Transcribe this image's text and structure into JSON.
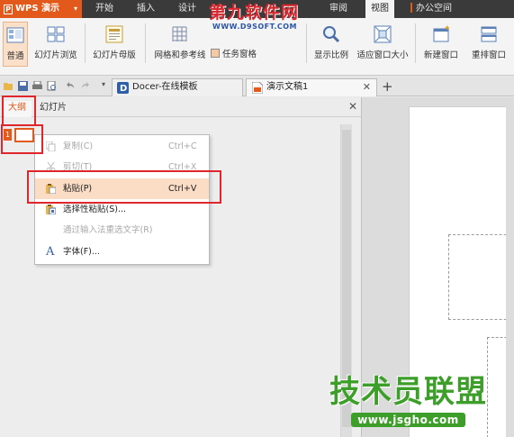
{
  "app": {
    "name": "WPS 演示",
    "icon": "wps-presentation-icon"
  },
  "menu_tabs": [
    "开始",
    "插入",
    "设计",
    "审阅",
    "视图",
    "办公空间"
  ],
  "watermark_top": {
    "title": "第九软件网",
    "url": "WWW.D9SOFT.COM"
  },
  "ribbon": {
    "normal": "普通",
    "slide_sorter": "幻灯片浏览",
    "slide_master": "幻灯片母版",
    "grid_guides": "网格和参考线",
    "task_pane": "任务窗格",
    "zoom": "显示比例",
    "fit_window": "适应窗口大小",
    "new_window": "新建窗口",
    "arrange": "重排窗口"
  },
  "doc_tabs": [
    {
      "label": "Docer-在线模板"
    },
    {
      "label": "演示文稿1"
    }
  ],
  "left_pane": {
    "tab_outline": "大纲",
    "tab_slides": "幻灯片",
    "slide_number": "1"
  },
  "context_menu": {
    "copy": {
      "label": "复制(C)",
      "shortcut": "Ctrl+C"
    },
    "cut": {
      "label": "剪切(T)",
      "shortcut": "Ctrl+X"
    },
    "paste": {
      "label": "粘贴(P)",
      "shortcut": "Ctrl+V"
    },
    "paste_special": {
      "label": "选择性粘贴(S)..."
    },
    "ime_reconvert": {
      "label": "通过输入法重选文字(R)"
    },
    "font": {
      "label": "字体(F)..."
    }
  },
  "watermark_bottom": {
    "title": "技术员联盟",
    "url": "www.jsgho.com"
  },
  "colors": {
    "accent": "#e2591b",
    "annotation": "#e0262d",
    "highlight": "#fbdcc5"
  }
}
